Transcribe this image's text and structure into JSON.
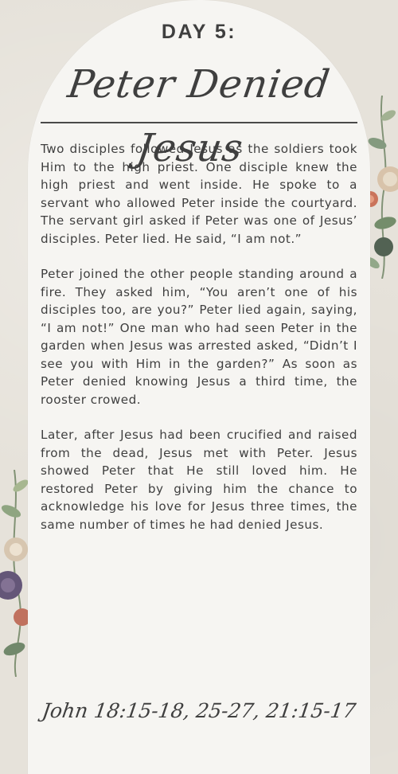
{
  "header": {
    "day_label": "DAY 5:",
    "title": "Peter Denied Jesus"
  },
  "content": {
    "paragraphs": [
      "Two disciples followed Jesus as the soldiers took Him to the high priest. One disciple knew the high priest and went inside. He spoke to a servant who allowed Peter inside the courtyard. The servant girl asked if Peter was one of Jesus’ disciples. Peter lied. He said, “I am not.”",
      "Peter joined the other people standing around a fire. They asked him, “You aren’t one of his disciples too, are you?” Peter lied again, saying, “I am not!” One man who had seen Peter in the garden when Jesus was arrested asked, “Didn’t I see you with Him in the garden?” As soon as Peter denied knowing Jesus a third time, the rooster crowed.",
      "Later, after Jesus had been crucified and raised from the dead, Jesus met with Peter. Jesus showed Peter that He still loved him. He restored Peter by giving him the chance to acknowledge his love for Jesus three times, the same number of times he had denied Jesus."
    ]
  },
  "footer": {
    "reference": "John 18:15-18, 25-27, 21:15-17"
  },
  "colors": {
    "background": "#e6e2da",
    "card": "#f6f5f2",
    "text": "#3f3f3f"
  }
}
